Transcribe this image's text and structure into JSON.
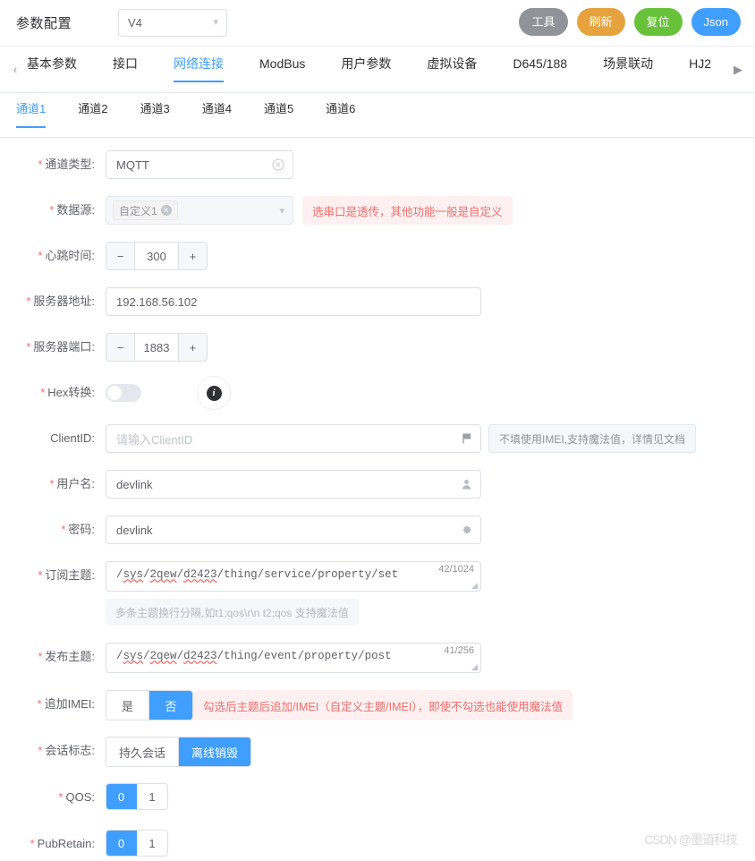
{
  "header": {
    "title": "参数配置",
    "version": {
      "value": "V4",
      "chevron": "chevron-down-icon"
    },
    "actions": [
      {
        "label": "工具",
        "color": "#909399",
        "name": "tools"
      },
      {
        "label": "刷新",
        "color": "#e6a23c",
        "name": "refresh"
      },
      {
        "label": "复位",
        "color": "#67c23a",
        "name": "reset"
      },
      {
        "label": "Json",
        "color": "#409eff",
        "name": "json"
      }
    ]
  },
  "primary_tabs": {
    "prev_arrow": "‹",
    "next_arrow": "▶",
    "items": [
      {
        "label": "基本参数",
        "active": false
      },
      {
        "label": "接口",
        "active": false
      },
      {
        "label": "网络连接",
        "active": true
      },
      {
        "label": "ModBus",
        "active": false
      },
      {
        "label": "用户参数",
        "active": false
      },
      {
        "label": "虚拟设备",
        "active": false
      },
      {
        "label": "D645/188",
        "active": false
      },
      {
        "label": "场景联动",
        "active": false
      },
      {
        "label": "HJ2",
        "active": false
      }
    ]
  },
  "channel_tabs": {
    "items": [
      {
        "label": "通道1",
        "active": true
      },
      {
        "label": "通道2",
        "active": false
      },
      {
        "label": "通道3",
        "active": false
      },
      {
        "label": "通道4",
        "active": false
      },
      {
        "label": "通道5",
        "active": false
      },
      {
        "label": "通道6",
        "active": false
      }
    ]
  },
  "form": {
    "channel_type": {
      "label": "通道类型:",
      "value": "MQTT",
      "clear_icon": "circle-close-icon"
    },
    "data_source": {
      "label": "数据源:",
      "tag": "自定义1",
      "tag_close": "✕",
      "chevron": "chevron-down-icon",
      "hint": "选串口是透传，其他功能一般是自定义"
    },
    "heartbeat": {
      "label": "心跳时间:",
      "value": "300",
      "minus": "−",
      "plus": "+"
    },
    "server_addr": {
      "label": "服务器地址:",
      "value": "192.168.56.102"
    },
    "server_port": {
      "label": "服务器端口:",
      "value": "1883",
      "minus": "−",
      "plus": "+"
    },
    "hex_convert": {
      "label": "Hex转换:",
      "on": false,
      "info_icon": "info-icon"
    },
    "client_id": {
      "label": "ClientID:",
      "placeholder": "请输入ClientID",
      "suffix_icon": "flag-icon",
      "hint": "不填使用IMEI,支持魔法值，详情见文档"
    },
    "username": {
      "label": "用户名:",
      "value": "devlink",
      "suffix_icon": "user-icon"
    },
    "password": {
      "label": "密码:",
      "value": "devlink",
      "suffix_icon": "gear-icon"
    },
    "sub_topic": {
      "label": "订阅主题:",
      "spell_parts": [
        "/",
        "sys",
        "/",
        "2qew",
        "/",
        "d2423"
      ],
      "rest": "/thing/service/property/set",
      "counter": "42/1024",
      "note": "多条主题换行分隔,如t1;qos\\r\\n t2;qos 支持魔法值"
    },
    "pub_topic": {
      "label": "发布主题:",
      "spell_parts": [
        "/",
        "sys",
        "/",
        "2qew",
        "/",
        "d2423"
      ],
      "rest": "/thing/event/property/post",
      "counter": "41/256"
    },
    "append_imei": {
      "label": "追加IMEI:",
      "options": [
        "是",
        "否"
      ],
      "selected": "否",
      "hint": "勾选后主题后追加/IMEI（自定义主题/IMEI），即使不勾选也能使用魔法值"
    },
    "session_flag": {
      "label": "会话标志:",
      "options": [
        "持久会话",
        "离线销毁"
      ],
      "selected": "离线销毁"
    },
    "qos": {
      "label": "QOS:",
      "options": [
        "0",
        "1"
      ],
      "selected": "0"
    },
    "pub_retain": {
      "label": "PubRetain:",
      "options": [
        "0",
        "1"
      ],
      "selected": "0"
    }
  },
  "watermark": "CSDN @墨道科技"
}
